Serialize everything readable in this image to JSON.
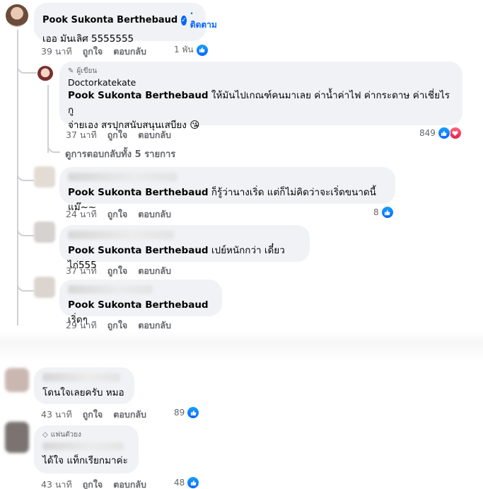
{
  "comment_main": {
    "author": "Pook Sukonta Berthebaud",
    "follow_label": "ติดตาม",
    "text": "เออ มันเลิศ 5555555",
    "time": "39 นาที",
    "like_label": "ถูกใจ",
    "reply_label": "ตอบกลับ",
    "reaction_count": "1 พัน"
  },
  "reply_author": {
    "badge": "ผู้เขียน",
    "author": "Doctorkatekate",
    "mention": "Pook Sukonta Berthebaud",
    "text_line1": " ให้มันไปเกณฑ์คนมาเลย ค่าน้ำค่าไฟ ค่ากระดาษ ค่าเชี่ยไร กู",
    "text_line2": "จ่ายเอง สรปุกสนับสนุนเสบียง",
    "emoji": "😘",
    "time": "37 นาที",
    "like_label": "ถูกใจ",
    "reply_label": "ตอบกลับ",
    "reaction_count": "849"
  },
  "view_replies": "ดูการตอบกลับทั้ง 5 รายการ",
  "reply2": {
    "mention": "Pook Sukonta Berthebaud",
    "text": " ก็รู้ว่านางเริ่ด แต่ก็ไม่คิดว่าจะเริ่ดขนาดนี้แม๊~~",
    "time": "24 นาที",
    "like_label": "ถูกใจ",
    "reply_label": "ตอบกลับ",
    "reaction_count": "8"
  },
  "reply3": {
    "mention": "Pook Sukonta Berthebaud",
    "text": " เปย์หนักกว่า เดี๋ยวไก่555",
    "time": "37 นาที",
    "like_label": "ถูกใจ",
    "reply_label": "ตอบกลับ"
  },
  "reply4": {
    "mention": "Pook Sukonta Berthebaud",
    "text": " เริ่ดๆ",
    "time": "29 นาที",
    "like_label": "ถูกใจ",
    "reply_label": "ตอบกลับ"
  },
  "comment5": {
    "text": "โดนใจเลยครับ หมอ",
    "time": "43 นาที",
    "like_label": "ถูกใจ",
    "reply_label": "ตอบกลับ",
    "reaction_count": "89"
  },
  "comment6": {
    "badge": "แฟนตัวยง",
    "text": "ได้ใจ แท็กเรียกมาค่ะ",
    "time": "43 นาที",
    "like_label": "ถูกใจ",
    "reply_label": "ตอบกลับ",
    "reaction_count": "48"
  },
  "colors": {
    "bubble": "#f0f2f5",
    "like_blue": "#0866ff",
    "love_red": "#e61e4d",
    "meta_gray": "#65676b"
  }
}
